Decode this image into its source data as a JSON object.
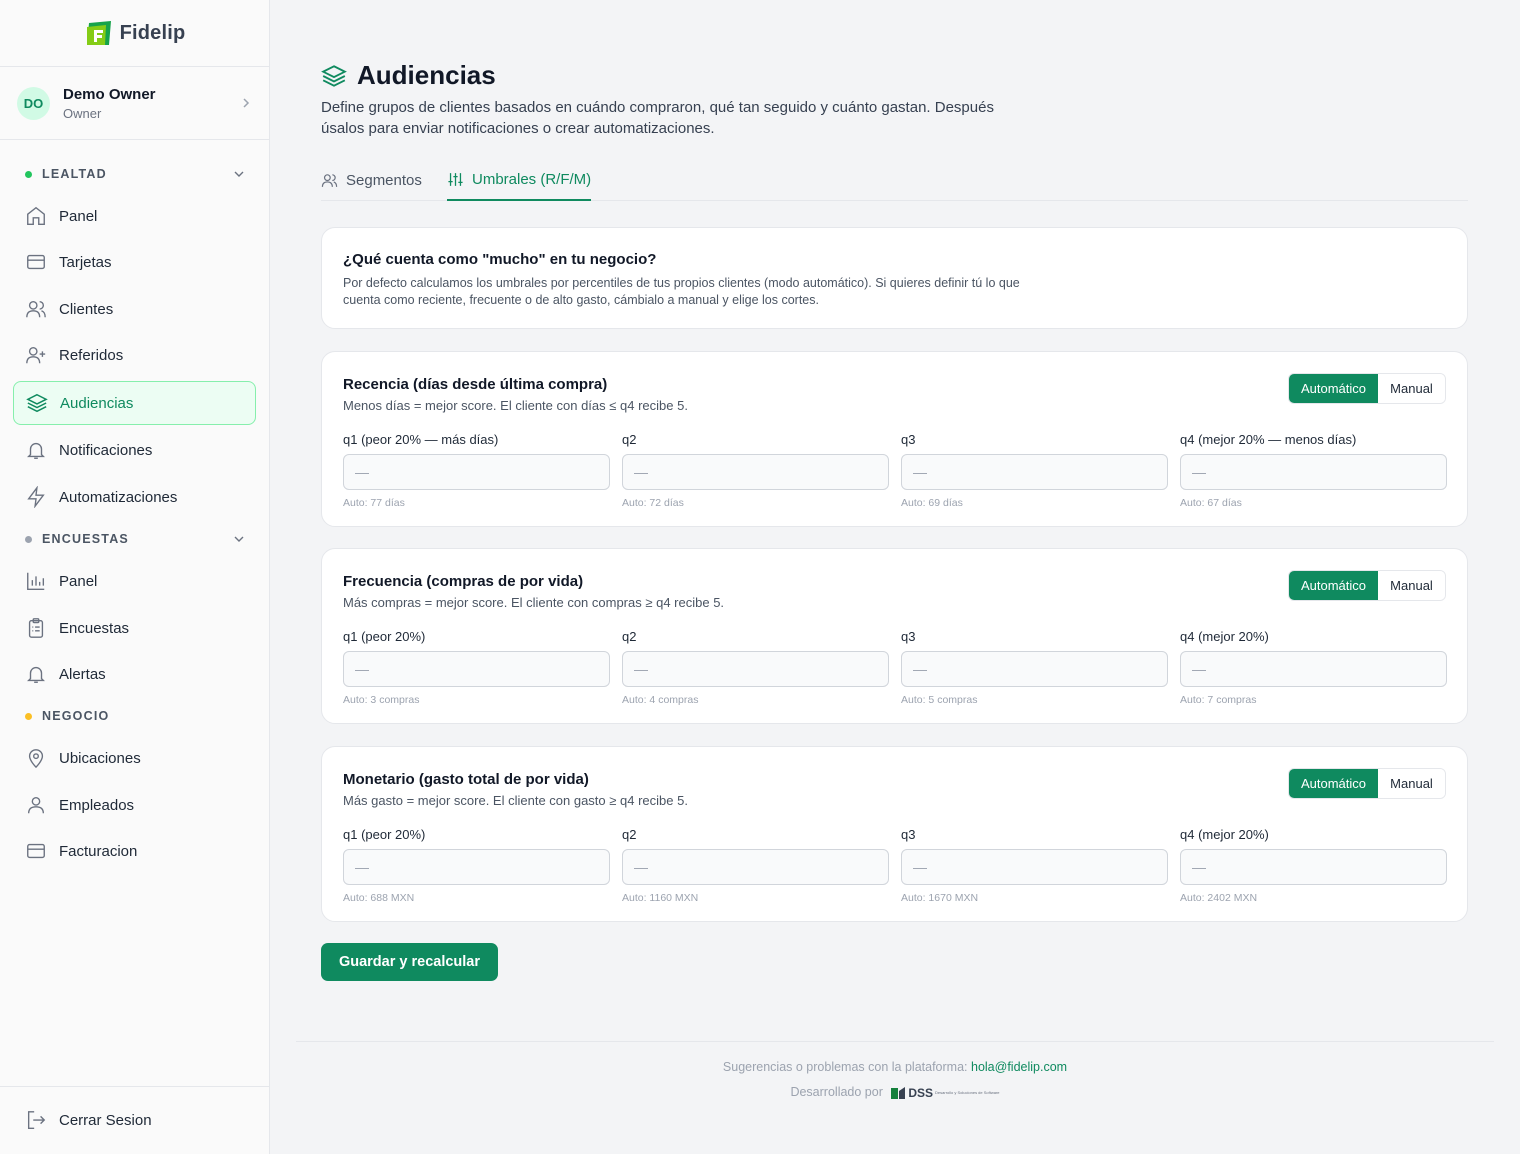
{
  "brand": {
    "name": "Fidelip",
    "accent": "#0f8a5f"
  },
  "user": {
    "initials": "DO",
    "name": "Demo Owner",
    "role": "Owner"
  },
  "sidebar": {
    "sections": [
      {
        "label": "LEALTAD",
        "dot_color": "#22c55e"
      },
      {
        "label": "ENCUESTAS",
        "dot_color": "#9ca3af"
      },
      {
        "label": "NEGOCIO",
        "dot_color": "#fbbf24"
      }
    ],
    "items": [
      {
        "label": "Panel",
        "icon": "home-icon"
      },
      {
        "label": "Tarjetas",
        "icon": "card-icon"
      },
      {
        "label": "Clientes",
        "icon": "users-icon"
      },
      {
        "label": "Referidos",
        "icon": "user-plus-icon"
      },
      {
        "label": "Audiencias",
        "icon": "layers-icon",
        "active": true
      },
      {
        "label": "Notificaciones",
        "icon": "bell-icon"
      },
      {
        "label": "Automatizaciones",
        "icon": "lightning-icon"
      },
      {
        "label": "Panel",
        "icon": "bar-chart-icon"
      },
      {
        "label": "Encuestas",
        "icon": "clipboard-icon"
      },
      {
        "label": "Alertas",
        "icon": "bell-icon"
      },
      {
        "label": "Ubicaciones",
        "icon": "map-pin-icon"
      },
      {
        "label": "Empleados",
        "icon": "user-icon"
      },
      {
        "label": "Facturacion",
        "icon": "card-icon"
      }
    ],
    "logout": "Cerrar Sesion"
  },
  "page": {
    "title": "Audiencias",
    "description": "Define grupos de clientes basados en cuándo compraron, qué tan seguido y cuánto gastan. Después úsalos para enviar notificaciones o crear automatizaciones.",
    "tabs": [
      {
        "label": "Segmentos"
      },
      {
        "label": "Umbrales (R/F/M)",
        "active": true
      }
    ]
  },
  "info_card": {
    "title": "¿Qué cuenta como \"mucho\" en tu negocio?",
    "text": "Por defecto calculamos los umbrales por percentiles de tus propios clientes (modo automático). Si quieres definir tú lo que cuenta como reciente, frecuente o de alto gasto, cámbialo a manual y elige los cortes."
  },
  "toggle": {
    "auto": "Automático",
    "manual": "Manual",
    "selected": "auto"
  },
  "metrics": [
    {
      "title": "Recencia (días desde última compra)",
      "subtitle": "Menos días = mejor score. El cliente con días ≤ q4 recibe 5.",
      "fields": [
        {
          "label": "q1 (peor 20% — más días)",
          "placeholder": "—",
          "hint": "Auto: 77 días"
        },
        {
          "label": "q2",
          "placeholder": "—",
          "hint": "Auto: 72 días"
        },
        {
          "label": "q3",
          "placeholder": "—",
          "hint": "Auto: 69 días"
        },
        {
          "label": "q4 (mejor 20% — menos días)",
          "placeholder": "—",
          "hint": "Auto: 67 días"
        }
      ]
    },
    {
      "title": "Frecuencia (compras de por vida)",
      "subtitle": "Más compras = mejor score. El cliente con compras ≥ q4 recibe 5.",
      "fields": [
        {
          "label": "q1 (peor 20%)",
          "placeholder": "—",
          "hint": "Auto: 3 compras"
        },
        {
          "label": "q2",
          "placeholder": "—",
          "hint": "Auto: 4 compras"
        },
        {
          "label": "q3",
          "placeholder": "—",
          "hint": "Auto: 5 compras"
        },
        {
          "label": "q4 (mejor 20%)",
          "placeholder": "—",
          "hint": "Auto: 7 compras"
        }
      ]
    },
    {
      "title": "Monetario (gasto total de por vida)",
      "subtitle": "Más gasto = mejor score. El cliente con gasto ≥ q4 recibe 5.",
      "fields": [
        {
          "label": "q1 (peor 20%)",
          "placeholder": "—",
          "hint": "Auto: 688 MXN"
        },
        {
          "label": "q2",
          "placeholder": "—",
          "hint": "Auto: 1160 MXN"
        },
        {
          "label": "q3",
          "placeholder": "—",
          "hint": "Auto: 1670 MXN"
        },
        {
          "label": "q4 (mejor 20%)",
          "placeholder": "—",
          "hint": "Auto: 2402 MXN"
        }
      ]
    }
  ],
  "save_button": "Guardar y recalcular",
  "footer": {
    "support_text": "Sugerencias o problemas con la plataforma:",
    "support_email": "hola@fidelip.com",
    "developed_by": "Desarrollado por",
    "dev_brand": "DSS",
    "dev_tagline": "Desarrollo y Soluciones de Software"
  }
}
